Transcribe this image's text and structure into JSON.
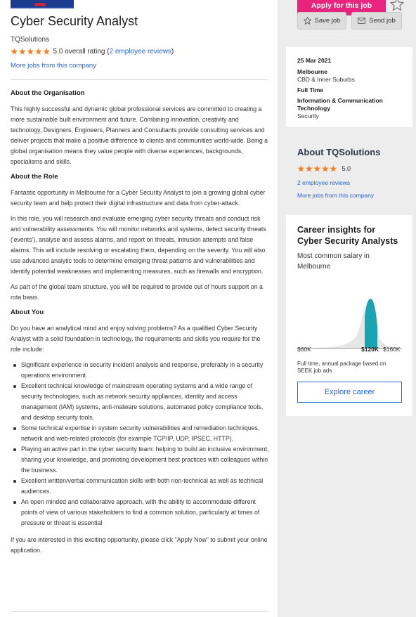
{
  "job": {
    "title": "Cyber Security Analyst",
    "company": "TQSolutions",
    "rating_text": "5.0 overall rating (",
    "reviews_link": "2 employee reviews",
    "rating_close": ")",
    "more_jobs": "More jobs from this company"
  },
  "description": {
    "h_org": "About the Organisation",
    "p_org": "This highly successful and dynamic global professional services are committed to creating a more sustainable built environment and future. Combining innovation, creativity and technology, Designers, Engineers, Planners and Consultants provide consulting services and deliver projects that make a positive difference to clients and communities world-wide. Being a global organisation means they value people with diverse experiences, backgrounds, specialisms and skills.",
    "h_role": "About the Role",
    "p_role1": "Fantastic opportunity in Melbourne for a Cyber Security Analyst to join a growing global cyber security team and help protect their digital infrastructure and data from cyber-attack.",
    "p_role2": "In this role, you will research and evaluate emerging cyber security threats and conduct risk and vulnerability assessments. You will monitor networks and systems, detect security threats ('events'), analyse and assess alarms, and report on threats, intrusion attempts and false alarms. This will include resolving or escalating them, depending on the severity. You will also use advanced analytic tools to determine emerging threat patterns and vulnerabilities and identify potential weaknesses and implementing measures, such as firewalls and encryption.",
    "p_role3": "As part of the global team structure, you will be required to provide out of hours support on a rota basis.",
    "h_you": "About You",
    "p_you": "Do you have an analytical mind and enjoy solving problems?  As a qualified Cyber Security Analyst with a solid foundation in technology, the requirements and skills you require for the role include:",
    "bullets": [
      "Significant experience in security incident analysis and response, preferably in a security operations environment.",
      "Excellent technical knowledge of mainstream operating systems and a wide range of security technologies, such as network security appliances, identity and access management (IAM) systems, anti-malware solutions, automated policy compliance tools, and desktop security tools.",
      "Some technical expertise in system security vulnerabilities and remediation techniques, network and web-related protocols (for example TCP/IP, UDP, IPSEC, HTTP).",
      "Playing an active part in the cyber security team: helping to build an inclusive environment, sharing your knowledge, and promoting development best practices with colleagues within the business.",
      "Excellent written/verbal communication skills with both non-technical as well as technical audiences.",
      "An open minded and collaborative approach, with the ability to accommodate different points of view of various stakeholders to find a common solution, particularly at times of pressure or threat is essential"
    ],
    "p_apply": "If you are interested in this exciting opportunity, please click \"Apply Now\" to submit your online application."
  },
  "sidebar": {
    "apply": "Apply for this job",
    "save": "Save job",
    "send": "Send job",
    "date": "25 Mar 2021",
    "location": "Melbourne",
    "area": "CBD & Inner Suburbs",
    "work_type": "Full Time",
    "classification": "Information & Communication Technology",
    "sub_class": "Security",
    "about_title": "About TQSolutions",
    "about_rating": "5.0",
    "about_reviews": "2 employee reviews",
    "about_more": "More jobs from this company",
    "insights_title": "Career insights for Cyber Security Analysts",
    "salary_caption": "Most common salary in Melbourne",
    "salary_low": "$60K",
    "salary_mid": "$120K",
    "salary_high": "$160K",
    "salary_note": "Full time, annual package based on SEEK job ads",
    "explore": "Explore career"
  },
  "colors": {
    "apply": "#e8247f",
    "link": "#2765cf",
    "star": "#f57c1f",
    "teal": "#1aa3b0"
  },
  "rating": {
    "stars": 5
  }
}
